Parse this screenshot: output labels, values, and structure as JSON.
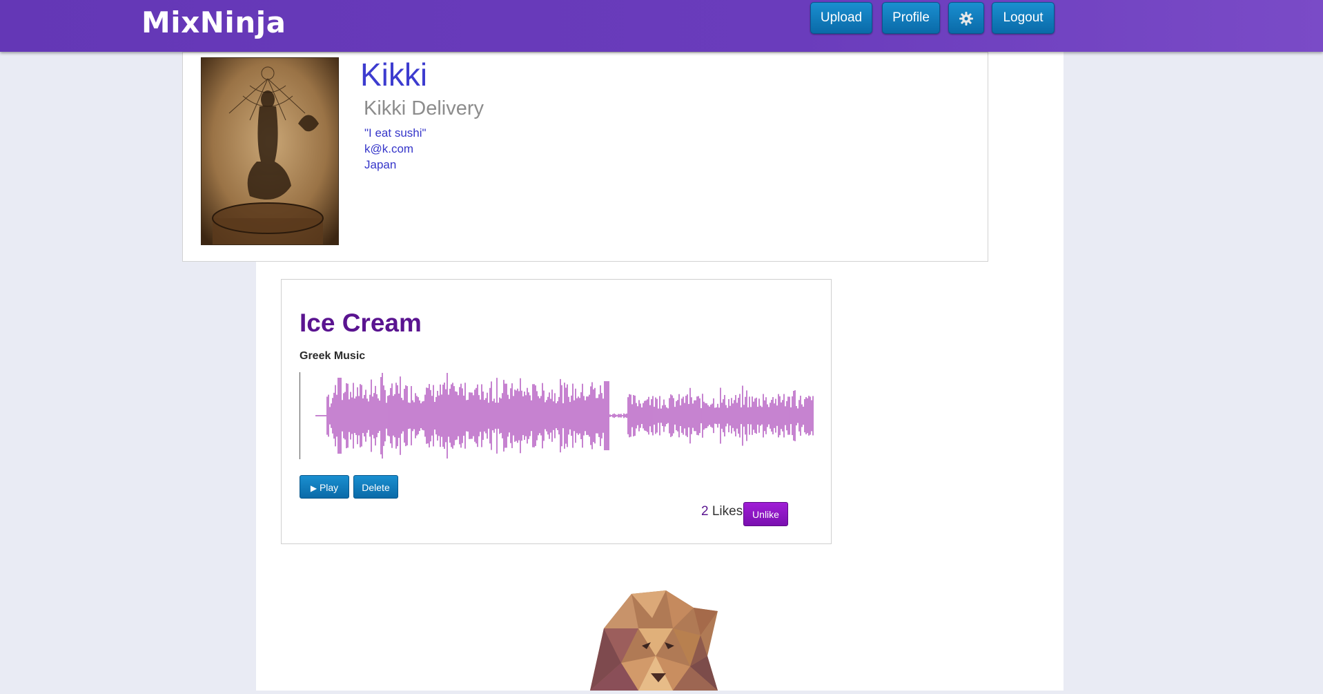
{
  "header": {
    "brand": "MixNinja",
    "upload_label": "Upload",
    "profile_label": "Profile",
    "settings_icon": "gear-icon",
    "logout_label": "Logout"
  },
  "profile": {
    "username": "Kikki",
    "full_name": "Kikki Delivery",
    "quote": "\"I eat sushi\"",
    "email": "k@k.com",
    "location": "Japan"
  },
  "track": {
    "title": "Ice Cream",
    "genre": "Greek Music",
    "play_label": "Play",
    "delete_label": "Delete",
    "likes_count": "2",
    "likes_label": "Likes",
    "unlike_label": "Unlike",
    "waveform_color": "#a030b0"
  },
  "colors": {
    "nav_purple": "#6a3cbc",
    "button_blue": "#0a6aa8",
    "title_purple": "#5a1490",
    "name_blue": "#3d3ccf"
  }
}
